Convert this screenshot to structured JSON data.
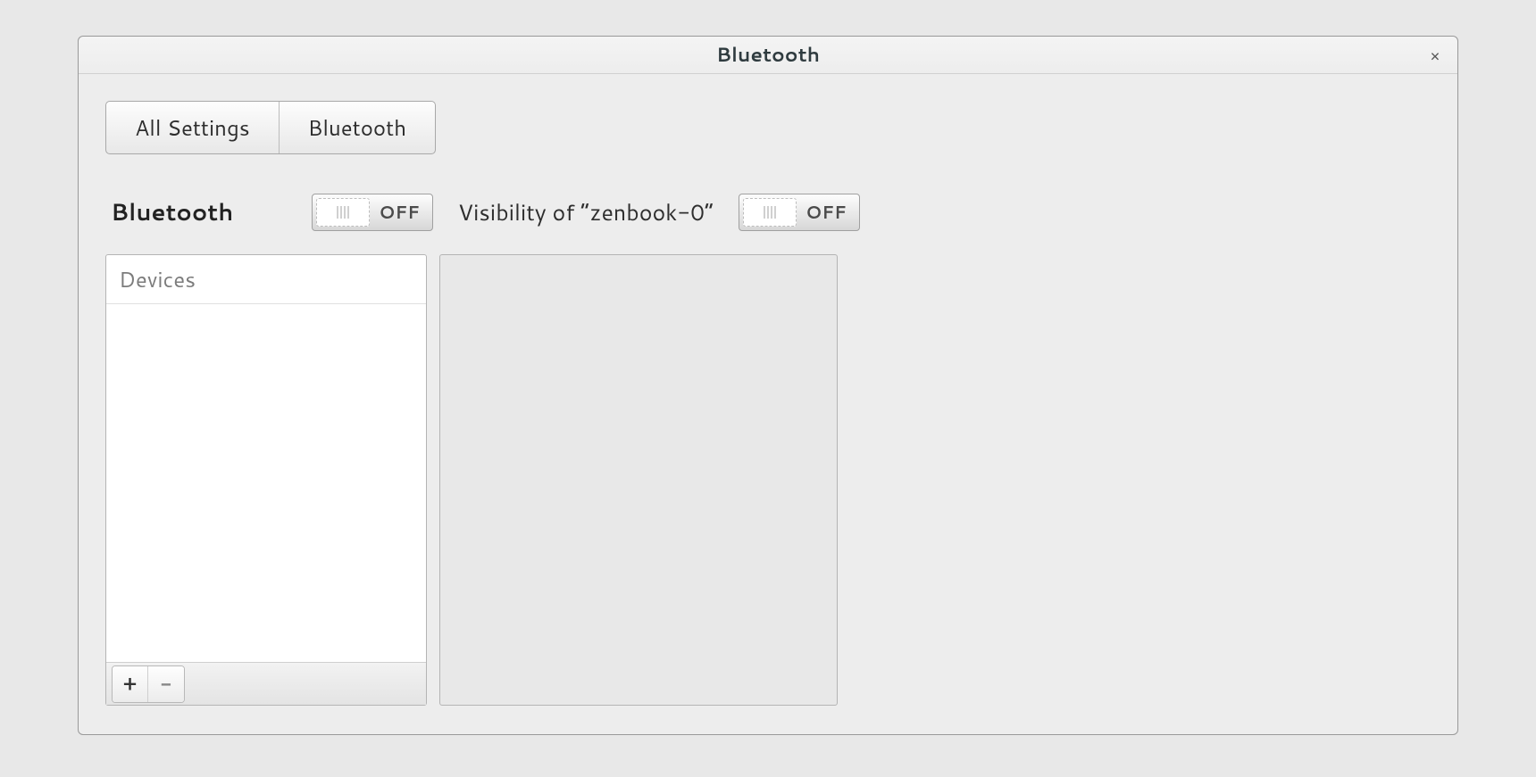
{
  "titlebar": {
    "title": "Bluetooth",
    "close_icon": "×"
  },
  "breadcrumb": {
    "all_settings": "All Settings",
    "current": "Bluetooth"
  },
  "bluetooth_section": {
    "label": "Bluetooth",
    "switch_state": "OFF"
  },
  "visibility_section": {
    "label": "Visibility of “zenbook-0”",
    "switch_state": "OFF"
  },
  "devices_panel": {
    "header": "Devices",
    "items": [],
    "add_icon": "+",
    "remove_icon": "−"
  }
}
